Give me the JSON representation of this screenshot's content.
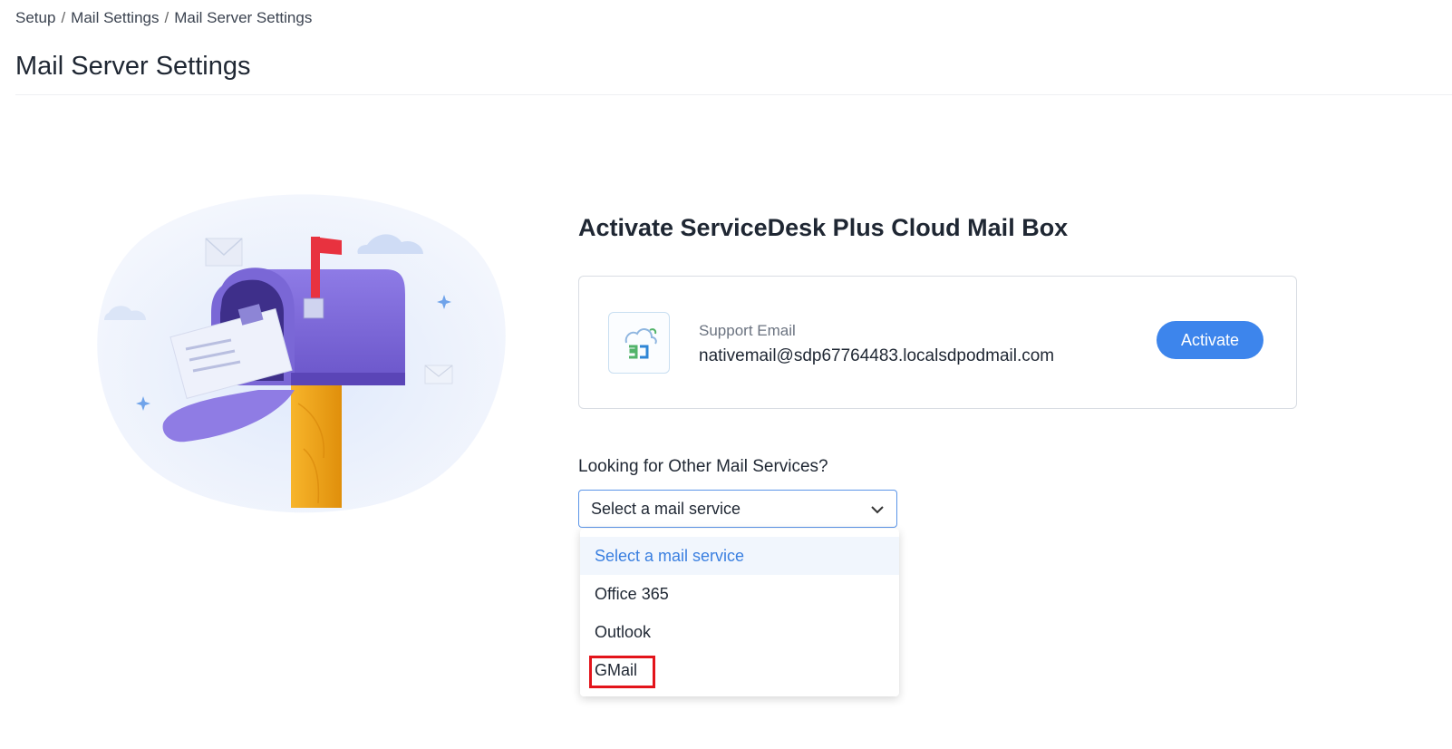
{
  "breadcrumb": {
    "items": [
      "Setup",
      "Mail Settings",
      "Mail Server Settings"
    ],
    "separator": "/"
  },
  "page_title": "Mail Server Settings",
  "main": {
    "heading": "Activate ServiceDesk Plus Cloud Mail Box",
    "mailbox_card": {
      "label": "Support Email",
      "email": "nativemail@sdp67764483.localsdpodmail.com",
      "activate_label": "Activate",
      "logo_icon": "servicedesk-cloud-logo-icon"
    },
    "other_services": {
      "label": "Looking for Other Mail Services?",
      "select": {
        "value": "Select a mail service",
        "options": [
          "Select a mail service",
          "Office 365",
          "Outlook",
          "GMail"
        ],
        "highlighted_option": "GMail"
      }
    }
  },
  "colors": {
    "accent": "#3d85ec",
    "highlight_border": "#e3141b",
    "selected_option_text": "#3a7fe0"
  }
}
